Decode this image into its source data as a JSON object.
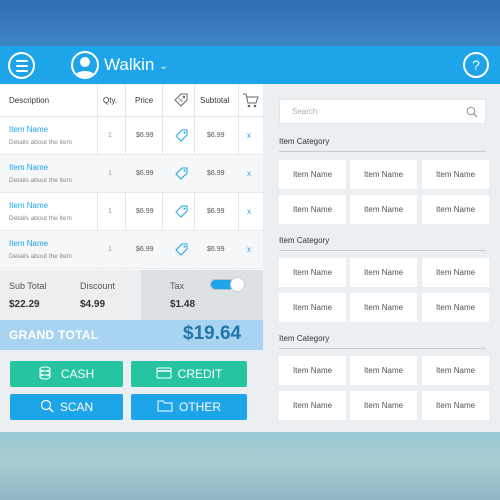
{
  "header": {
    "customer_name": "Walkin"
  },
  "order_table": {
    "columns": {
      "description": "Description",
      "qty": "Qty.",
      "price": "Price",
      "subtotal": "Subtotal"
    },
    "rows": [
      {
        "name": "Item Name",
        "details": "Details about the item",
        "qty": "1",
        "price": "$6.99",
        "subtotal": "$6.99",
        "remove": "x"
      },
      {
        "name": "Item Name",
        "details": "Details about the item",
        "qty": "1",
        "price": "$6.99",
        "subtotal": "$6.99",
        "remove": "x"
      },
      {
        "name": "Item Name",
        "details": "Details about the item",
        "qty": "1",
        "price": "$6.99",
        "subtotal": "$6.99",
        "remove": "x"
      },
      {
        "name": "Item Name",
        "details": "Details about the item",
        "qty": "1",
        "price": "$6.99",
        "subtotal": "$6.99",
        "remove": "x"
      }
    ]
  },
  "totals": {
    "subtotal_label": "Sub Total",
    "subtotal_value": "$22.29",
    "discount_label": "Discount",
    "discount_value": "$4.99",
    "tax_label": "Tax",
    "tax_value": "$1.48",
    "tax_enabled": true
  },
  "grand_total": {
    "label": "GRAND TOTAL",
    "value": "$19.64"
  },
  "payment_buttons": {
    "cash": "CASH",
    "credit": "CREDIT",
    "scan": "SCAN",
    "other": "OTHER"
  },
  "catalog": {
    "search_placeholder": "Search",
    "categories": [
      {
        "label": "Item Category",
        "items": [
          "Item Name",
          "Item Name",
          "Item Name",
          "Item Name",
          "Item Name",
          "Item Name"
        ]
      },
      {
        "label": "Item Category",
        "items": [
          "Item Name",
          "Item Name",
          "Item Name",
          "Item Name",
          "Item Name",
          "Item Name"
        ]
      },
      {
        "label": "Item Category",
        "items": [
          "Item Name",
          "Item Name",
          "Item Name",
          "Item Name",
          "Item Name",
          "Item Name"
        ]
      }
    ]
  },
  "colors": {
    "accent_blue": "#1ea4e9",
    "accent_green": "#26c4a0",
    "grand_total_bg": "#a8d4f2",
    "grand_total_value": "#2276a8"
  },
  "icons": {
    "menu": "hamburger-menu-icon",
    "avatar": "user-avatar-icon",
    "help": "help-question-icon",
    "tag": "price-tag-icon",
    "cart": "shopping-cart-icon",
    "search": "search-icon",
    "cash": "coins-icon",
    "credit": "credit-card-icon",
    "scan": "scan-magnifier-icon",
    "other": "folder-icon"
  }
}
